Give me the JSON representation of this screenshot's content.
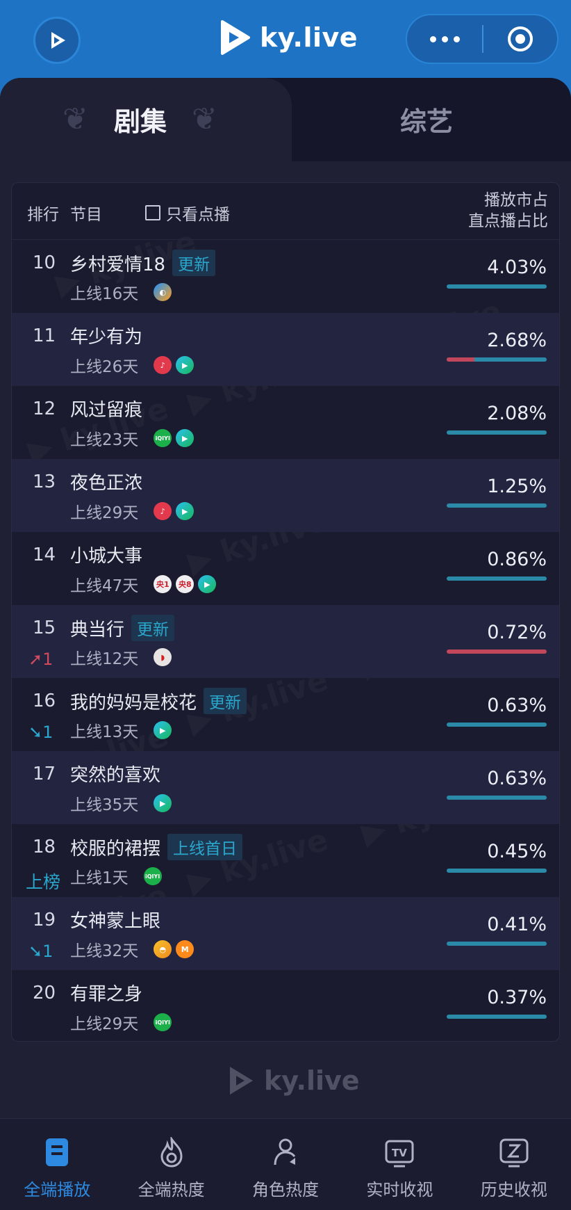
{
  "header": {
    "brand": "ky.live"
  },
  "tabs": [
    {
      "label": "剧集",
      "active": true
    },
    {
      "label": "综艺",
      "active": false
    }
  ],
  "table_header": {
    "rank": "排行",
    "program": "节目",
    "filter_label": "只看点播",
    "share_line1": "播放市占",
    "share_line2": "直点播占比"
  },
  "rows": [
    {
      "rank": "10",
      "title": "乡村爱情18",
      "badge": "更新",
      "days": "上线16天",
      "change": "",
      "pct": "4.03%",
      "red_fraction": 0,
      "icons": [
        "youku"
      ]
    },
    {
      "rank": "11",
      "title": "年少有为",
      "badge": "",
      "days": "上线26天",
      "change": "",
      "pct": "2.68%",
      "red_fraction": 0.28,
      "icons": [
        "cctv",
        "tencent"
      ]
    },
    {
      "rank": "12",
      "title": "风过留痕",
      "badge": "",
      "days": "上线23天",
      "change": "",
      "pct": "2.08%",
      "red_fraction": 0,
      "icons": [
        "iqiyi",
        "tencent"
      ]
    },
    {
      "rank": "13",
      "title": "夜色正浓",
      "badge": "",
      "days": "上线29天",
      "change": "",
      "pct": "1.25%",
      "red_fraction": 0,
      "icons": [
        "cctv",
        "tencent"
      ]
    },
    {
      "rank": "14",
      "title": "小城大事",
      "badge": "",
      "days": "上线47天",
      "change": "",
      "pct": "0.86%",
      "red_fraction": 0,
      "icons": [
        "cctv1",
        "cctv8",
        "tencent"
      ]
    },
    {
      "rank": "15",
      "title": "典当行",
      "badge": "更新",
      "days": "上线12天",
      "change": "1",
      "change_dir": "up",
      "pct": "0.72%",
      "red_fraction": 1,
      "icons": [
        "dragon"
      ]
    },
    {
      "rank": "16",
      "title": "我的妈妈是校花",
      "badge": "更新",
      "days": "上线13天",
      "change": "1",
      "change_dir": "down",
      "pct": "0.63%",
      "red_fraction": 0,
      "icons": [
        "tencent"
      ]
    },
    {
      "rank": "17",
      "title": "突然的喜欢",
      "badge": "",
      "days": "上线35天",
      "change": "",
      "pct": "0.63%",
      "red_fraction": 0,
      "icons": [
        "tencent"
      ]
    },
    {
      "rank": "18",
      "title": "校服的裙摆",
      "badge": "上线首日",
      "days": "上线1天",
      "change": "上榜",
      "change_dir": "new",
      "pct": "0.45%",
      "red_fraction": 0,
      "icons": [
        "iqiyi"
      ]
    },
    {
      "rank": "19",
      "title": "女神蒙上眼",
      "badge": "",
      "days": "上线32天",
      "change": "1",
      "change_dir": "down",
      "pct": "0.41%",
      "red_fraction": 0,
      "icons": [
        "yellow",
        "mango"
      ]
    },
    {
      "rank": "20",
      "title": "有罪之身",
      "badge": "",
      "days": "上线29天",
      "change": "",
      "pct": "0.37%",
      "red_fraction": 0,
      "icons": [
        "iqiyi"
      ]
    }
  ],
  "icon_text": {
    "iqiyi": "iQIYI",
    "cctv1": "央1",
    "cctv8": "央8",
    "mango": "M"
  },
  "footer_brand": "ky.live",
  "nav": [
    {
      "label": "全端播放",
      "icon": "bookmark-icon",
      "active": true
    },
    {
      "label": "全端热度",
      "icon": "flame-icon",
      "active": false
    },
    {
      "label": "角色热度",
      "icon": "person-icon",
      "active": false
    },
    {
      "label": "实时收视",
      "icon": "tv-icon",
      "active": false
    },
    {
      "label": "历史收视",
      "icon": "history-icon",
      "active": false
    }
  ],
  "colors": {
    "header_blue": "#1e73c4",
    "accent_teal": "#2aa7cd",
    "accent_red": "#c2475a",
    "active_nav": "#2d8ae0"
  }
}
